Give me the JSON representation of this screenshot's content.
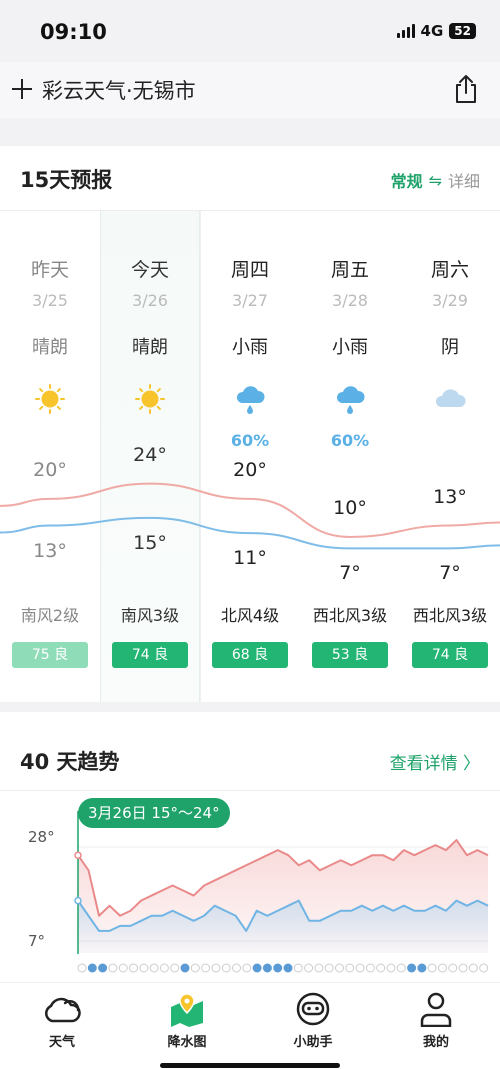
{
  "status_bar": {
    "time": "09:10",
    "network": "4G",
    "battery": "52"
  },
  "nav": {
    "title": "彩云天气·无锡市"
  },
  "forecast15": {
    "title": "15天预报",
    "toggle_active": "常规",
    "toggle_swap": "⇋",
    "toggle_inactive": "详细",
    "days": [
      {
        "name": "昨天",
        "date": "3/25",
        "cond": "晴朗",
        "icon": "sun-icon",
        "precip": "",
        "high": "20°",
        "low": "13°",
        "wind": "南风2级",
        "aqi": "75 良"
      },
      {
        "name": "今天",
        "date": "3/26",
        "cond": "晴朗",
        "icon": "sun-icon",
        "precip": "",
        "high": "24°",
        "low": "15°",
        "wind": "南风3级",
        "aqi": "74 良"
      },
      {
        "name": "周四",
        "date": "3/27",
        "cond": "小雨",
        "icon": "rain-cloud-icon",
        "precip": "60%",
        "high": "20°",
        "low": "11°",
        "wind": "北风4级",
        "aqi": "68 良"
      },
      {
        "name": "周五",
        "date": "3/28",
        "cond": "小雨",
        "icon": "rain-cloud-icon",
        "precip": "60%",
        "high": "10°",
        "low": "7°",
        "wind": "西北风3级",
        "aqi": "53 良"
      },
      {
        "name": "周六",
        "date": "3/29",
        "cond": "阴",
        "icon": "cloud-icon",
        "precip": "",
        "high": "13°",
        "low": "7°",
        "wind": "西北风3级",
        "aqi": "74 良"
      }
    ],
    "chart_data": {
      "type": "line",
      "categories": [
        "3/25",
        "3/26",
        "3/27",
        "3/28",
        "3/29"
      ],
      "series": [
        {
          "values": [
            20,
            24,
            20,
            10,
            13
          ]
        },
        {
          "values": [
            13,
            15,
            11,
            7,
            7
          ]
        }
      ],
      "colors": {
        "high": "#f0aaa6",
        "low": "#7fbde8"
      }
    }
  },
  "trend40": {
    "title": "40 天趋势",
    "link": "查看详情 〉",
    "pill": "3月26日 15°～24°",
    "y_top": "28°",
    "y_bottom": "7°",
    "chart_data": {
      "type": "area",
      "x_count": 40,
      "ylim": [
        7,
        28
      ],
      "series": [
        {
          "values": [
            24,
            21,
            12,
            14,
            12,
            13,
            15,
            16,
            17,
            18,
            17,
            16,
            18,
            19,
            20,
            21,
            22,
            23,
            24,
            25,
            24,
            22,
            23,
            21,
            22,
            23,
            22,
            23,
            24,
            24,
            23,
            25,
            24,
            25,
            26,
            25,
            27,
            24,
            25,
            24
          ]
        },
        {
          "values": [
            15,
            12,
            9,
            9,
            10,
            10,
            11,
            12,
            12,
            13,
            12,
            11,
            12,
            14,
            13,
            12,
            9,
            13,
            12,
            13,
            14,
            15,
            11,
            11,
            12,
            13,
            13,
            14,
            13,
            14,
            13,
            14,
            13,
            13,
            14,
            13,
            15,
            14,
            15,
            14
          ]
        }
      ],
      "rain_days": [
        1,
        2,
        10,
        17,
        18,
        19,
        20,
        32,
        33
      ],
      "colors": {
        "high": "#e9898a",
        "low": "#6fb4e4",
        "accent": "#1fa36a"
      }
    }
  },
  "bottom_nav": {
    "tabs": [
      {
        "label": "天气",
        "icon": "cloud-icon"
      },
      {
        "label": "降水图",
        "icon": "map-pin-icon"
      },
      {
        "label": "小助手",
        "icon": "assistant-icon"
      },
      {
        "label": "我的",
        "icon": "person-icon"
      }
    ]
  },
  "colors": {
    "accent": "#1fa36a",
    "aqi_past": "#8fdcb8",
    "aqi": "#22b573",
    "sun": "#f7c52b",
    "rain": "#5bb1e6"
  }
}
